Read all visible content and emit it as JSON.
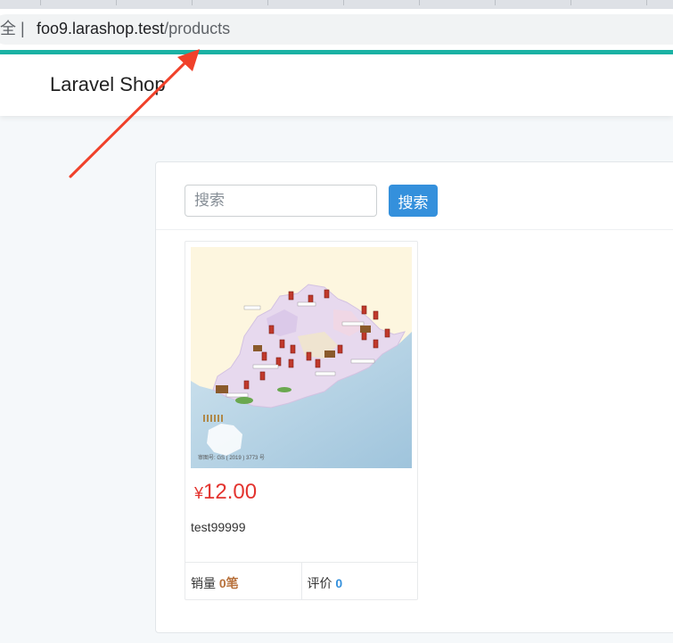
{
  "browser": {
    "security_label": "全 |",
    "url_host": "foo9.larashop.test",
    "url_path": "/products"
  },
  "navbar": {
    "brand": "Laravel Shop"
  },
  "search": {
    "placeholder": "搜索",
    "button_label": "搜索"
  },
  "products": [
    {
      "currency_symbol": "¥",
      "price": "12.00",
      "title": "test99999",
      "sales_label": "销量",
      "sales_value": "0笔",
      "review_label": "评价",
      "review_value": "0",
      "map_caption": "审图号: GS ( 2019 ) 3773 号"
    }
  ],
  "colors": {
    "accent": "#3490dc",
    "price": "#e3342f",
    "load_bar": "#1bb3a5",
    "annotation_arrow": "#f0412a"
  }
}
